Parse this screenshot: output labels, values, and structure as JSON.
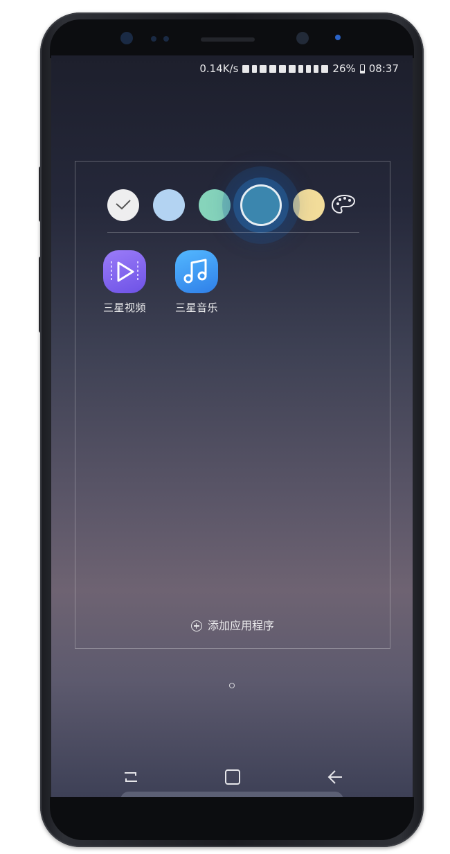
{
  "status_bar": {
    "network_speed": "0.14K/s",
    "battery_percent": "26%",
    "time": "08:37"
  },
  "folder": {
    "color_options": [
      {
        "name": "white",
        "color": "#eeeeef",
        "selected": false
      },
      {
        "name": "light-blue",
        "color": "#b3d3f2",
        "selected": false
      },
      {
        "name": "mint",
        "color": "#86d4bb",
        "selected": false
      },
      {
        "name": "blue",
        "color": "#3b86ae",
        "selected": true
      },
      {
        "name": "yellow",
        "color": "#f2dc9a",
        "selected": false
      }
    ],
    "apps": [
      {
        "label": "三星视频",
        "icon": "video-play-icon"
      },
      {
        "label": "三星音乐",
        "icon": "music-note-icon"
      }
    ],
    "add_apps_label": "添加应用程序"
  },
  "navigation": {
    "buttons": [
      "recent-apps-icon",
      "home-icon",
      "back-icon"
    ]
  }
}
